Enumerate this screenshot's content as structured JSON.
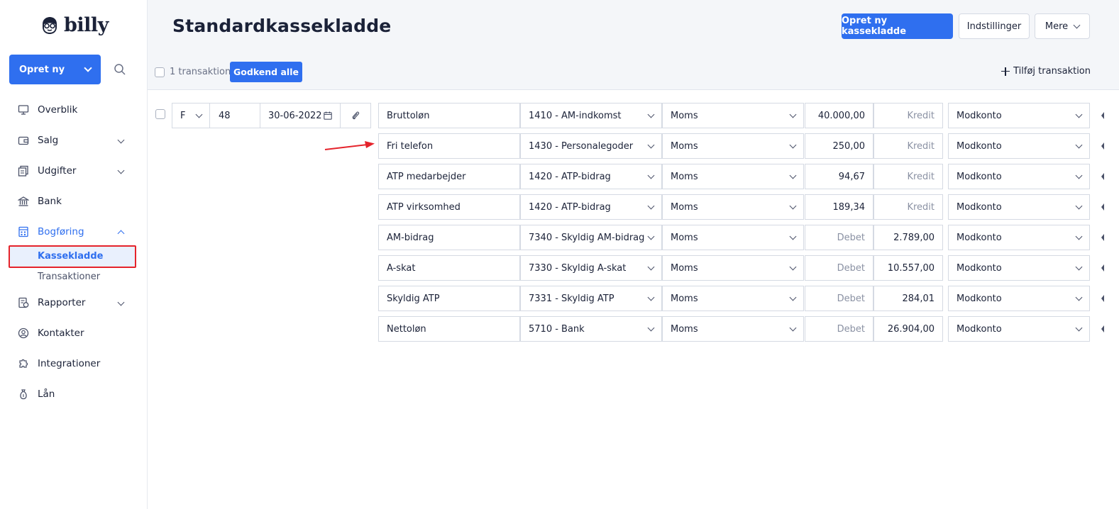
{
  "app": {
    "logo_text": "billy"
  },
  "sidebar": {
    "create_label": "Opret ny",
    "items": [
      {
        "label": "Overblik",
        "icon": "monitor-icon"
      },
      {
        "label": "Salg",
        "icon": "wallet-icon"
      },
      {
        "label": "Udgifter",
        "icon": "receipts-icon"
      },
      {
        "label": "Bank",
        "icon": "bank-icon"
      },
      {
        "label": "Bogføring",
        "icon": "ledger-icon"
      },
      {
        "label": "Rapporter",
        "icon": "report-icon"
      },
      {
        "label": "Kontakter",
        "icon": "contacts-icon"
      },
      {
        "label": "Integrationer",
        "icon": "puzzle-icon"
      },
      {
        "label": "Lån",
        "icon": "moneybag-icon"
      }
    ],
    "sub_items": [
      {
        "label": "Kassekladde"
      },
      {
        "label": "Transaktioner"
      }
    ]
  },
  "header": {
    "title": "Standardkassekladde",
    "new_button": "Opret ny kassekladde",
    "settings_button": "Indstillinger",
    "more_button": "Mere"
  },
  "toolbar": {
    "count_label": "1 transaktion",
    "approve_label": "Godkend alle",
    "add_label": "Tilføj transaktion"
  },
  "entry": {
    "type": "F",
    "number": "48",
    "date": "30-06-2022"
  },
  "lines": [
    {
      "text": "Bruttoløn",
      "account": "1410 - AM-indkomst",
      "vat": "Moms",
      "debet": "40.000,00",
      "kredit": "Kredit",
      "contra": "Modkonto"
    },
    {
      "text": "Fri telefon",
      "account": "1430 - Personalegoder",
      "vat": "Moms",
      "debet": "250,00",
      "kredit": "Kredit",
      "contra": "Modkonto"
    },
    {
      "text": "ATP medarbejder",
      "account": "1420 - ATP-bidrag",
      "vat": "Moms",
      "debet": "94,67",
      "kredit": "Kredit",
      "contra": "Modkonto"
    },
    {
      "text": "ATP virksomhed",
      "account": "1420 - ATP-bidrag",
      "vat": "Moms",
      "debet": "189,34",
      "kredit": "Kredit",
      "contra": "Modkonto"
    },
    {
      "text": "AM-bidrag",
      "account": "7340 - Skyldig AM-bidrag",
      "vat": "Moms",
      "debet": "Debet",
      "kredit": "2.789,00",
      "contra": "Modkonto"
    },
    {
      "text": "A-skat",
      "account": "7330 - Skyldig A-skat",
      "vat": "Moms",
      "debet": "Debet",
      "kredit": "10.557,00",
      "contra": "Modkonto"
    },
    {
      "text": "Skyldig ATP",
      "account": "7331 - Skyldig ATP",
      "vat": "Moms",
      "debet": "Debet",
      "kredit": "284,01",
      "contra": "Modkonto"
    },
    {
      "text": "Nettoløn",
      "account": "5710 - Bank",
      "vat": "Moms",
      "debet": "Debet",
      "kredit": "26.904,00",
      "contra": "Modkonto"
    }
  ],
  "colors": {
    "accent": "#2f6fef",
    "highlight": "#e5232b"
  }
}
